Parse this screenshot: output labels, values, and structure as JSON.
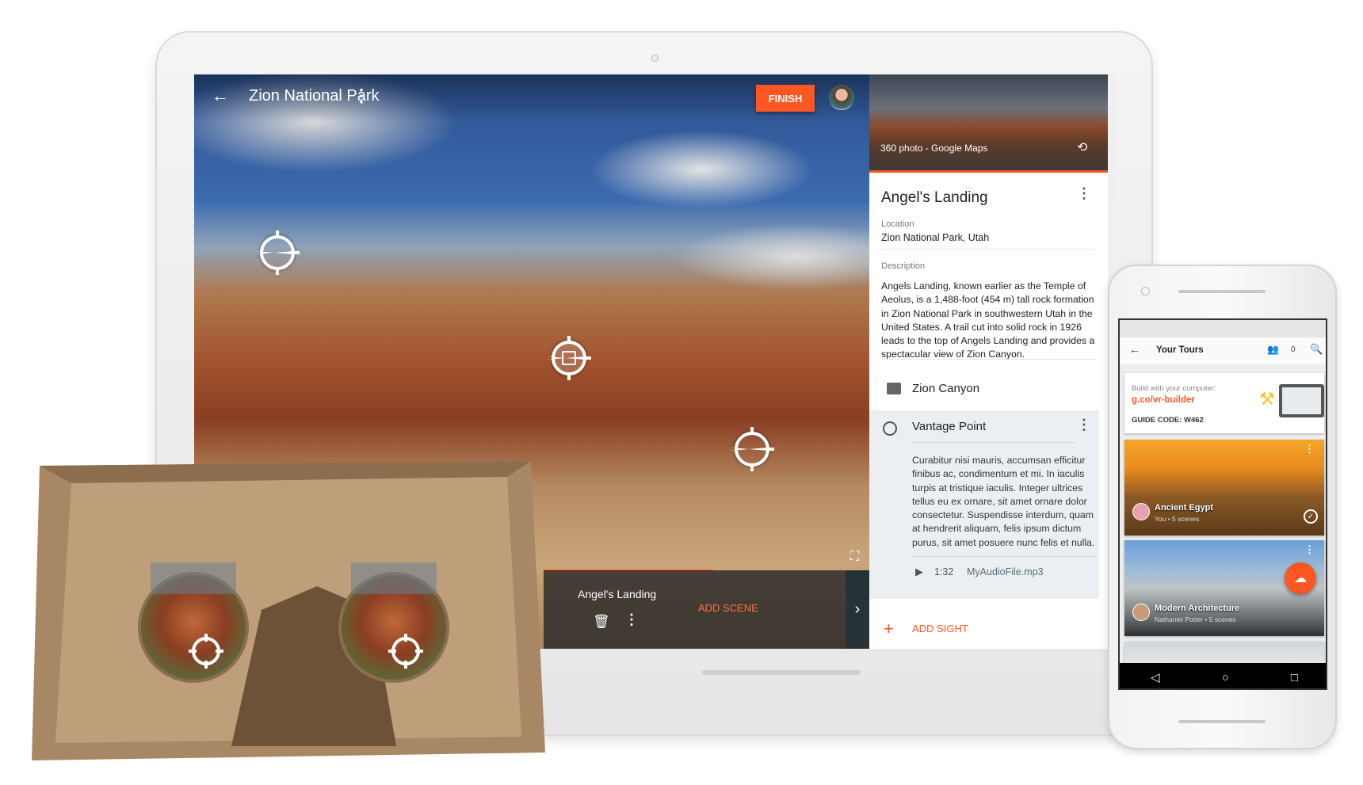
{
  "laptop_app": {
    "title": "Zion National Park",
    "finish_label": "FINISH",
    "scene_strip": {
      "scene_title": "Angel's Landing",
      "add_scene_label": "ADD SCENE",
      "progress_percent": 52
    },
    "panel": {
      "thumbnail_label": "360 photo - Google Maps",
      "title": "Angel's Landing",
      "location_label": "Location",
      "location_value": "Zion National Park, Utah",
      "description_label": "Description",
      "description": "Angels Landing, known earlier as the Temple of Aeolus, is a 1,488-foot (454 m) tall rock formation in Zion National Park in southwestern Utah in the United States. A trail cut into solid rock in 1926 leads to the top of Angels Landing and provides a spectacular view of Zion Canyon.",
      "sights": [
        {
          "name": "Zion Canyon",
          "icon": "image-icon"
        },
        {
          "name": "Vantage Point",
          "icon": "target-icon",
          "text": "Curabitur nisi mauris, accumsan efficitur finibus ac, condimentum et mi. In iaculis turpis at tristique iaculis. Integer ultrices tellus eu ex ornare, sit amet ornare dolor consectetur. Suspendisse interdum, quam at hendrerit aliquam, felis ipsum dictum purus, sit amet posuere nunc felis et nulla.",
          "audio_duration": "1:32",
          "audio_file": "MyAudioFile.mp3"
        }
      ],
      "add_sight_label": "ADD SIGHT"
    },
    "accent_color": "#ff5722"
  },
  "phone_app": {
    "title": "Your Tours",
    "people_count": "0",
    "build_card": {
      "label": "Build with your computer:",
      "link": "g.co/vr-builder",
      "guide_code": "GUIDE CODE: W462"
    },
    "tours": [
      {
        "title": "Ancient Egypt",
        "author": "You",
        "scenes": "• 5 scenes"
      },
      {
        "title": "Modern Architecture",
        "author": "Nathaniel Potter",
        "scenes": "• 5 scenes"
      }
    ]
  }
}
